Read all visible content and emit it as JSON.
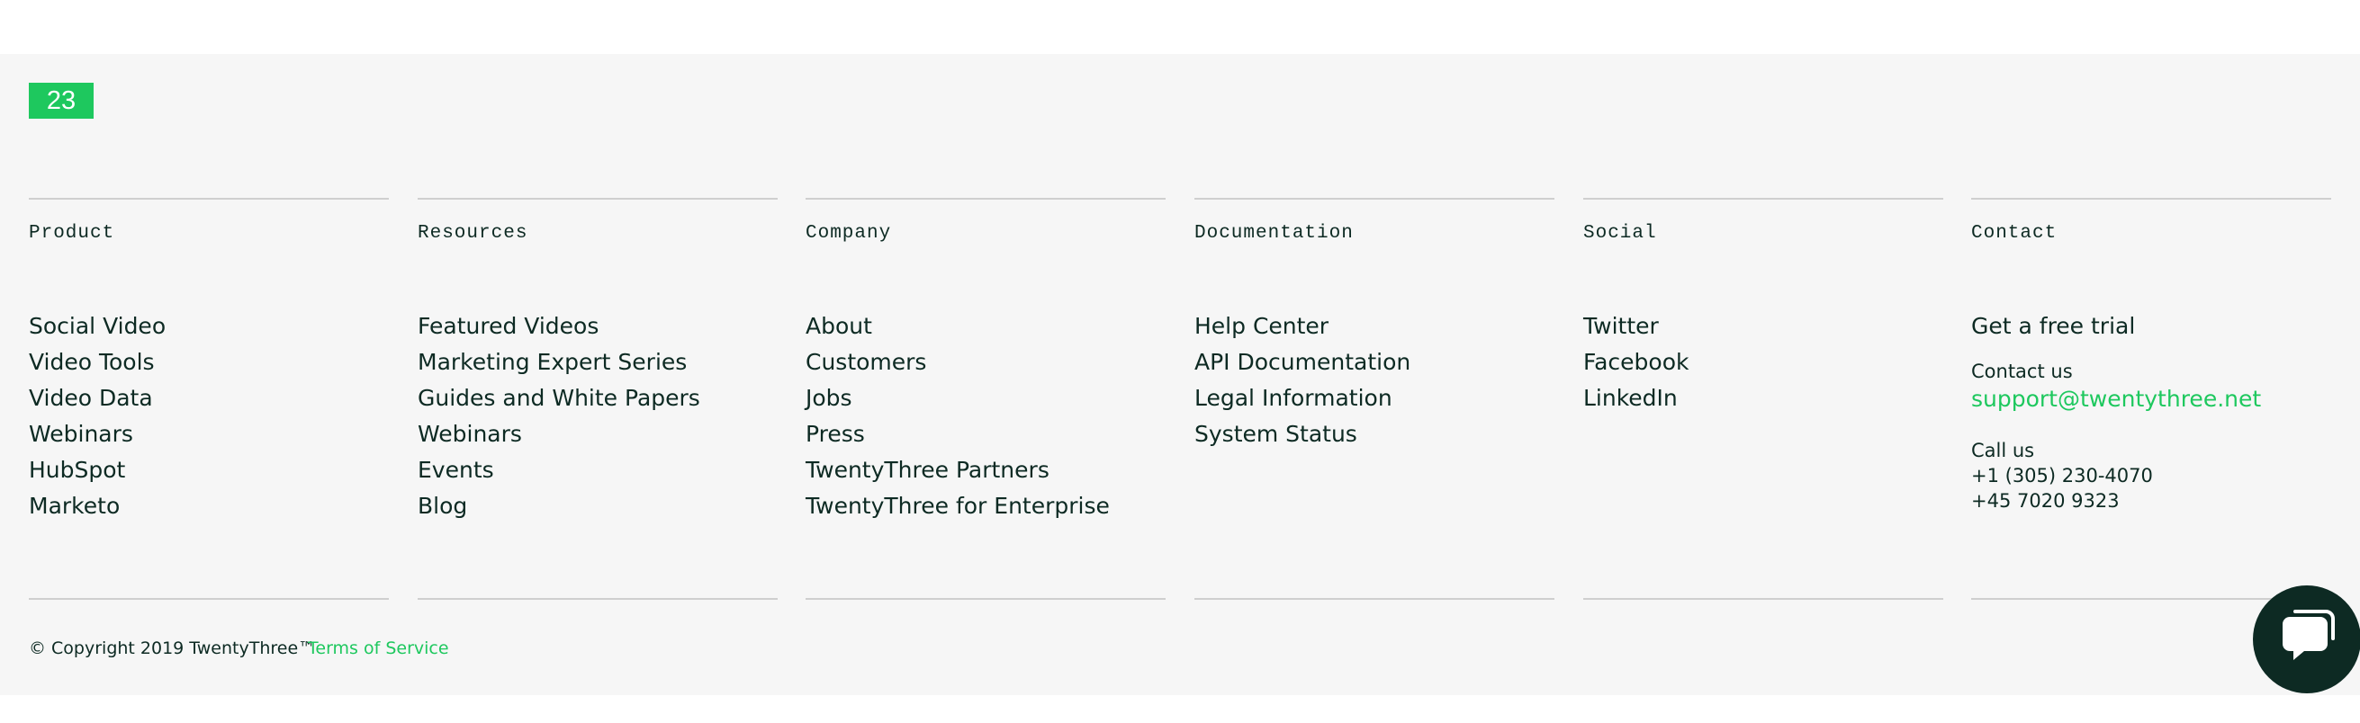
{
  "logo": {
    "text": "23"
  },
  "columns": [
    {
      "heading": "Product",
      "links": [
        "Social Video",
        "Video Tools",
        "Video Data",
        "Webinars",
        "HubSpot",
        "Marketo"
      ]
    },
    {
      "heading": "Resources",
      "links": [
        "Featured Videos",
        "Marketing Expert Series",
        "Guides and White Papers",
        "Webinars",
        "Events",
        "Blog"
      ]
    },
    {
      "heading": "Company",
      "links": [
        "About",
        "Customers",
        "Jobs",
        "Press",
        "TwentyThree Partners",
        "TwentyThree for Enterprise"
      ]
    },
    {
      "heading": "Documentation",
      "links": [
        "Help Center",
        "API Documentation",
        "Legal Information",
        "System Status"
      ]
    },
    {
      "heading": "Social",
      "links": [
        "Twitter",
        "Facebook",
        "LinkedIn"
      ]
    }
  ],
  "contact": {
    "heading": "Contact",
    "trial": "Get a free trial",
    "contact_label": "Contact us",
    "email": "support@twentythree.net",
    "call_label": "Call us",
    "phones": [
      "+1 (305) 230-4070",
      "+45 7020 9323"
    ]
  },
  "legal": {
    "copyright": "© Copyright 2019 TwentyThree™",
    "terms": "Terms of Service"
  },
  "colors": {
    "accent": "#1ec85e",
    "text": "#0d2a23",
    "footer_bg": "#f6f6f6"
  },
  "icons": {
    "chat": "chat-bubble-icon"
  }
}
